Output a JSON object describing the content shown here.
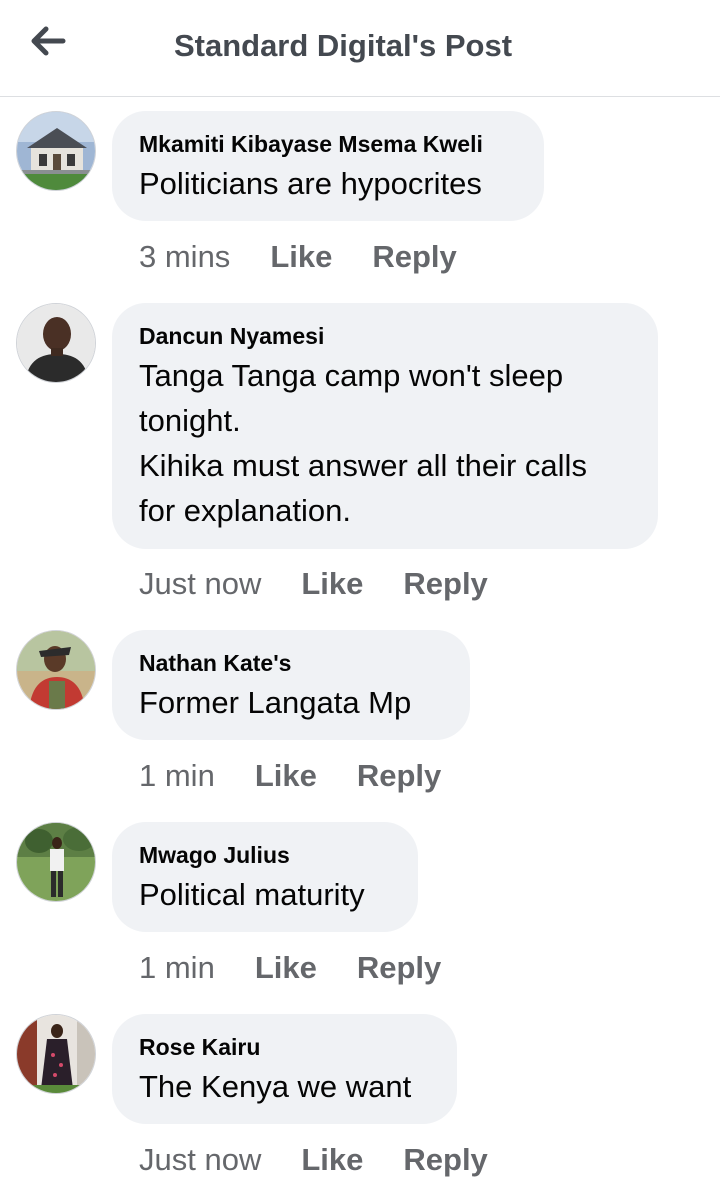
{
  "header": {
    "title": "Standard Digital's Post",
    "back_icon": "arrow-left-icon"
  },
  "colors": {
    "bubble": "#f0f2f5",
    "secondary_text": "#65676b",
    "title_text": "#444950"
  },
  "comments": [
    {
      "author": "Mkamiti Kibayase Msema Kweli",
      "text": "Politicians are hypocrites",
      "time": "3 mins",
      "like": "Like",
      "reply": "Reply"
    },
    {
      "author": "Dancun Nyamesi",
      "text_lines": [
        "Tanga Tanga camp won't sleep",
        "tonight.",
        "Kihika must answer all their calls",
        "for explanation."
      ],
      "time": "Just now",
      "like": "Like",
      "reply": "Reply"
    },
    {
      "author": "Nathan Kate's",
      "text": "Former Langata Mp",
      "time": "1 min",
      "like": "Like",
      "reply": "Reply"
    },
    {
      "author": "Mwago Julius",
      "text": "Political maturity",
      "time": "1 min",
      "like": "Like",
      "reply": "Reply"
    },
    {
      "author": "Rose Kairu",
      "text": "The Kenya we want",
      "time": "Just now",
      "like": "Like",
      "reply": "Reply"
    }
  ]
}
